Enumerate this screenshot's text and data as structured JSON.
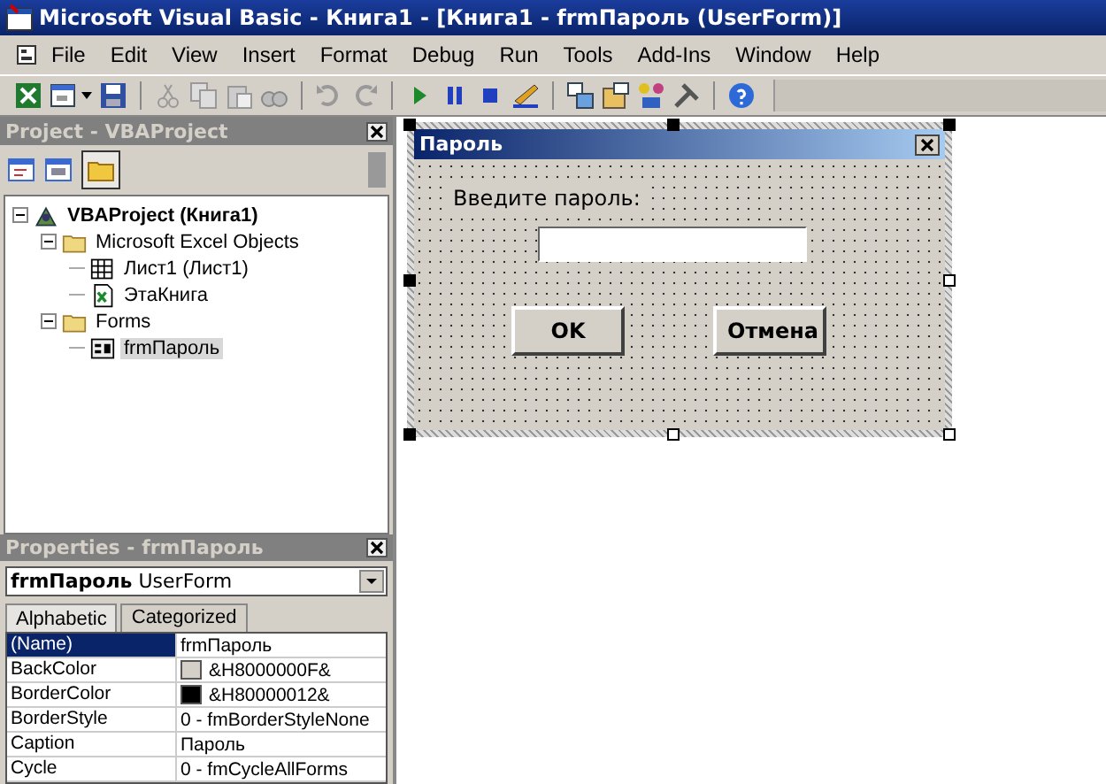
{
  "window": {
    "title": "Microsoft Visual Basic - Книга1 - [Книга1 - frmПароль (UserForm)]"
  },
  "menu": [
    "File",
    "Edit",
    "View",
    "Insert",
    "Format",
    "Debug",
    "Run",
    "Tools",
    "Add-Ins",
    "Window",
    "Help"
  ],
  "project": {
    "title": "Project - VBAProject",
    "tree": [
      {
        "label": "VBAProject (Книга1)",
        "kind": "project",
        "expanded": true,
        "selected": false,
        "children": [
          {
            "label": "Microsoft Excel Objects",
            "kind": "folder",
            "expanded": true,
            "selected": false,
            "children": [
              {
                "label": "Лист1 (Лист1)",
                "kind": "sheet",
                "selected": false
              },
              {
                "label": "ЭтаКнига",
                "kind": "workbook",
                "selected": false
              }
            ]
          },
          {
            "label": "Forms",
            "kind": "folder",
            "expanded": true,
            "selected": false,
            "children": [
              {
                "label": "frmПароль",
                "kind": "form",
                "selected": true
              }
            ]
          }
        ]
      }
    ]
  },
  "properties": {
    "title": "Properties - frmПароль",
    "object_name": "frmПароль",
    "object_type": "UserForm",
    "tabs": [
      {
        "label": "Alphabetic",
        "selected": true
      },
      {
        "label": "Categorized",
        "selected": false
      }
    ],
    "rows": [
      {
        "name": "(Name)",
        "value": "frmПароль",
        "selected": true
      },
      {
        "name": "BackColor",
        "value": "&H8000000F&",
        "selected": false,
        "color": "#d4d0c8"
      },
      {
        "name": "BorderColor",
        "value": "&H80000012&",
        "selected": false,
        "color": "#000000"
      },
      {
        "name": "BorderStyle",
        "value": "0 - fmBorderStyleNone",
        "selected": false
      },
      {
        "name": "Caption",
        "value": "Пароль",
        "selected": false
      },
      {
        "name": "Cycle",
        "value": "0 - fmCycleAllForms",
        "selected": false
      }
    ]
  },
  "form": {
    "title": "Пароль",
    "label": "Введите пароль:",
    "buttons": [
      "OK",
      "Отмена"
    ]
  }
}
